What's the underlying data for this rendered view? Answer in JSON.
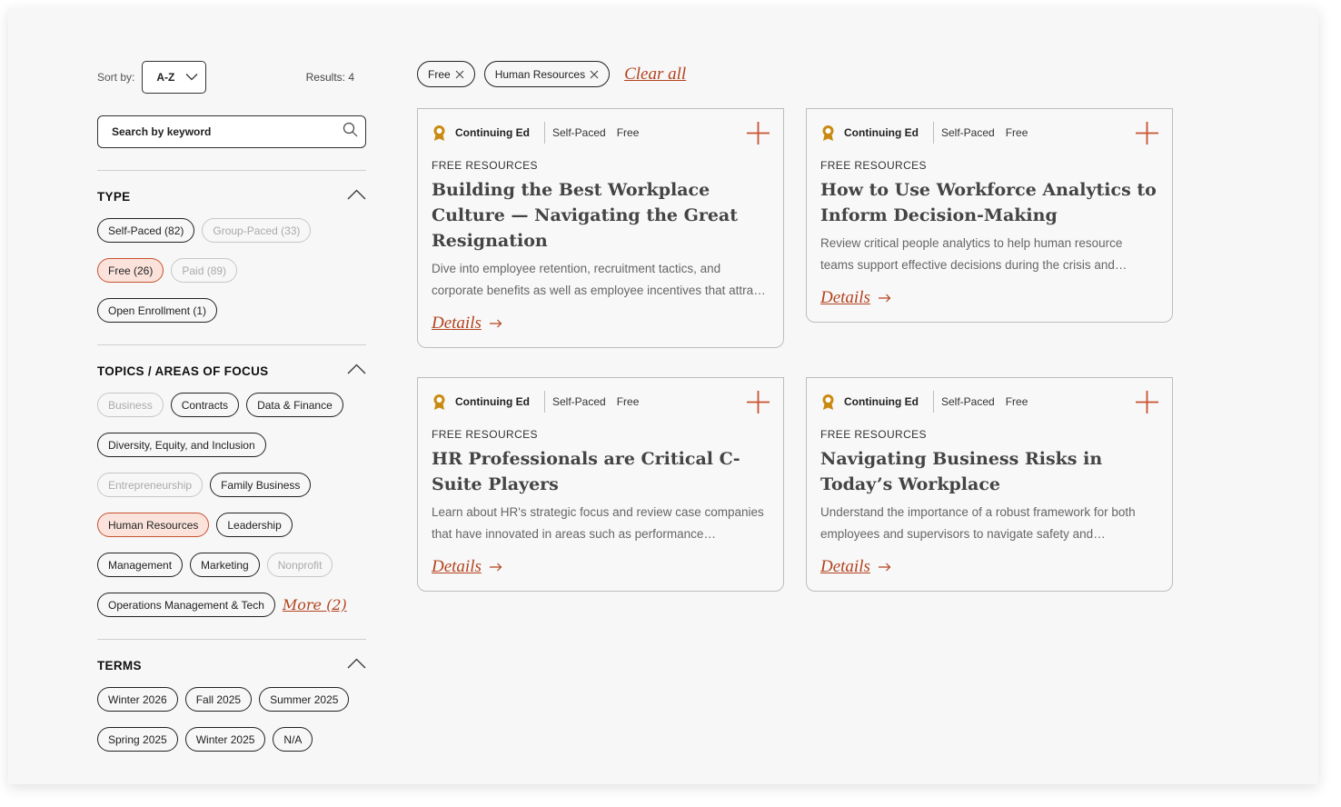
{
  "sort": {
    "label": "Sort by:",
    "value": "A-Z"
  },
  "results": "Results: 4",
  "search": {
    "placeholder": "Search by keyword"
  },
  "sections": {
    "type": {
      "title": "TYPE",
      "rows": [
        [
          {
            "label": "Self-Paced (82)",
            "state": "normal"
          },
          {
            "label": "Group-Paced (33)",
            "state": "disabled"
          }
        ],
        [
          {
            "label": "Free (26)",
            "state": "active"
          },
          {
            "label": "Paid (89)",
            "state": "disabled"
          }
        ],
        [
          {
            "label": "Open Enrollment (1)",
            "state": "normal"
          }
        ]
      ]
    },
    "topics": {
      "title": "TOPICS / AREAS OF FOCUS",
      "rows": [
        [
          {
            "label": "Business",
            "state": "disabled"
          },
          {
            "label": "Contracts",
            "state": "normal"
          },
          {
            "label": "Data & Finance",
            "state": "normal"
          }
        ],
        [
          {
            "label": "Diversity, Equity, and Inclusion",
            "state": "normal"
          }
        ],
        [
          {
            "label": "Entrepreneurship",
            "state": "disabled"
          },
          {
            "label": "Family Business",
            "state": "normal"
          }
        ],
        [
          {
            "label": "Human Resources",
            "state": "active"
          },
          {
            "label": "Leadership",
            "state": "normal"
          }
        ],
        [
          {
            "label": "Management",
            "state": "normal"
          },
          {
            "label": "Marketing",
            "state": "normal"
          },
          {
            "label": "Nonprofit",
            "state": "disabled"
          }
        ],
        [
          {
            "label": "Operations Management & Tech",
            "state": "normal"
          }
        ]
      ],
      "more": "More (2)"
    },
    "terms": {
      "title": "TERMS",
      "rows": [
        [
          {
            "label": "Winter 2026",
            "state": "normal"
          },
          {
            "label": "Fall 2025",
            "state": "normal"
          },
          {
            "label": "Summer 2025",
            "state": "normal"
          }
        ],
        [
          {
            "label": "Spring 2025",
            "state": "normal"
          },
          {
            "label": "Winter 2025",
            "state": "normal"
          },
          {
            "label": "N/A",
            "state": "normal"
          }
        ]
      ]
    }
  },
  "active_filters": [
    "Free",
    "Human Resources"
  ],
  "clear_all": "Clear all",
  "cards": [
    {
      "badge": "Continuing Ed",
      "pace": "Self-Paced",
      "price": "Free",
      "eyebrow": "FREE RESOURCES",
      "title": "Building the Best Workplace Culture — Navigating the Great Resignation",
      "desc": "Dive into employee retention, recruitment tactics, and corporate benefits as well as employee incentives that attract and keep top talent.",
      "link": "Details"
    },
    {
      "badge": "Continuing Ed",
      "pace": "Self-Paced",
      "price": "Free",
      "eyebrow": "FREE RESOURCES",
      "title": "How to Use Workforce Analytics to Inform Decision-Making",
      "desc": "Review critical people analytics to help human resource teams support effective decisions during the crisis and beyond.",
      "link": "Details"
    },
    {
      "badge": "Continuing Ed",
      "pace": "Self-Paced",
      "price": "Free",
      "eyebrow": "FREE RESOURCES",
      "title": "HR Professionals are Critical C-Suite Players",
      "desc": "Learn about HR's strategic focus and review case companies that have innovated in areas such as performance management and culture.",
      "link": "Details"
    },
    {
      "badge": "Continuing Ed",
      "pace": "Self-Paced",
      "price": "Free",
      "eyebrow": "FREE RESOURCES",
      "title": "Navigating Business Risks in Today’s Workplace",
      "desc": "Understand the importance of a robust framework for both employees and supervisors to navigate safety and compliance risks.",
      "link": "Details"
    }
  ]
}
